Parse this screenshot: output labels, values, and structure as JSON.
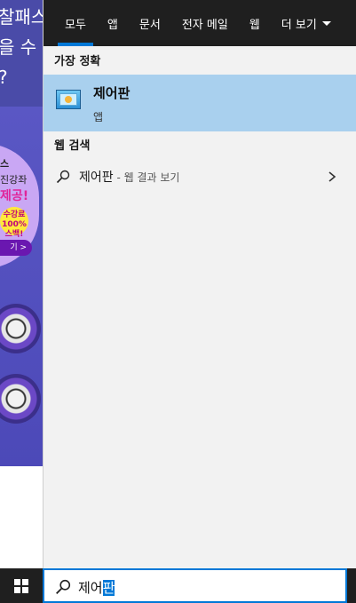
{
  "background_page": {
    "lines": [
      "찰패스",
      "을 수",
      "?"
    ],
    "banner_line1": "스",
    "banner_line2": "진강좌",
    "banner_line3": "제공!",
    "badge_top": "수강료",
    "badge_mid": "100%",
    "badge_bot": "스백!",
    "pill_text": "기 >"
  },
  "tabs": [
    {
      "label": "모두",
      "active": true
    },
    {
      "label": "앱"
    },
    {
      "label": "문서"
    },
    {
      "label": "전자 메일"
    },
    {
      "label": "웹"
    },
    {
      "label": "더 보기"
    }
  ],
  "best_match": {
    "section_label": "가장 정확",
    "name": "제어판",
    "type": "앱",
    "icon": "control-panel-icon"
  },
  "web_search": {
    "section_label": "웹 검색",
    "query": "제어판",
    "suffix": " - 웹 결과 보기"
  },
  "taskbar": {
    "start_icon": "windows-logo-icon",
    "search_text_plain": "제어",
    "search_text_selected": "판",
    "accent": "#0078d7"
  }
}
